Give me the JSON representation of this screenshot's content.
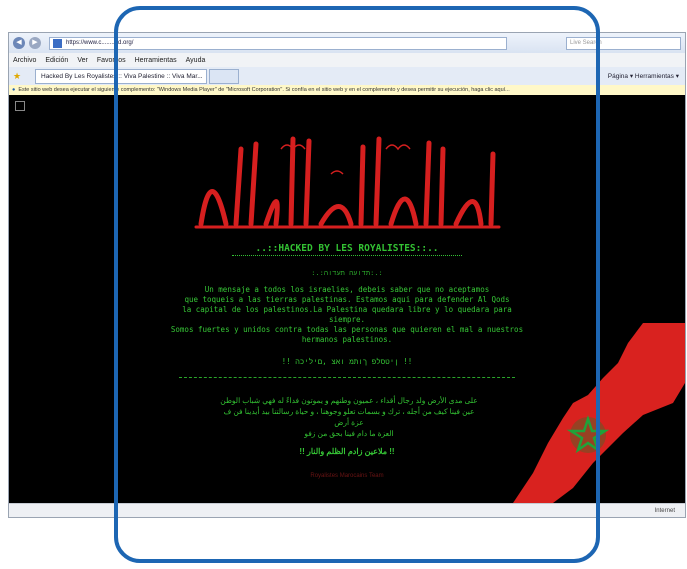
{
  "browser": {
    "url": "https://www.c..........d.org/",
    "search_placeholder": "Live Search",
    "menu": [
      "Archivo",
      "Edición",
      "Ver",
      "Favoritos",
      "Herramientas",
      "Ayuda"
    ],
    "tab_title": "Hacked By Les Royalistes :: Viva Palestine :: Viva Mar...",
    "tools": "Página ▾  Herramientas ▾",
    "infobar_text": "Este sitio web desea ejecutar el siguiente complemento: \"Windows Media Player\" de \"Microsoft Corporation\". Si confía en el sitio web y en el complemento y desea permitir su ejecución, haga clic aquí...",
    "status": "Internet"
  },
  "page": {
    "hacked_title": "..::HACKED BY LES ROYALISTES::..",
    "hebrew_head": ":.:תדועה תעדוה:.:",
    "spanish_lines": [
      "Un mensaje a todos los israelies, debeis saber que no aceptamos",
      "que toqueis a las tierras palestinas. Estamos aqui para defender Al Qods",
      "la capital de los palestinos.La Palestina quedara libre y lo quedara para",
      "siempre.",
      "Somos fuertes y unidos contra todas las personas que quieren el mal a nuestros",
      "hermanos palestinos."
    ],
    "hebrew_line": "!! ןיטסלפ ךותמ ואצ ,םיליכה !!",
    "arabic_lines": [
      "على مدى الأرض ولد رجال أقداء ، عميون وطنهم و يموتون فداءً له فهي شباب الوطن",
      "عين فينا كيف من أجله ، ترك و بسمات تعلو وجوهنا ، و حياة رسالتنا بيد أيدينا فن ف",
      "عزة أرض",
      "العزة ما دام فينا بحق من زفو"
    ],
    "arabic_final": "!! ملاعين زادم الظلم والنار !!",
    "signature": "Royalistes Marocains Team"
  }
}
